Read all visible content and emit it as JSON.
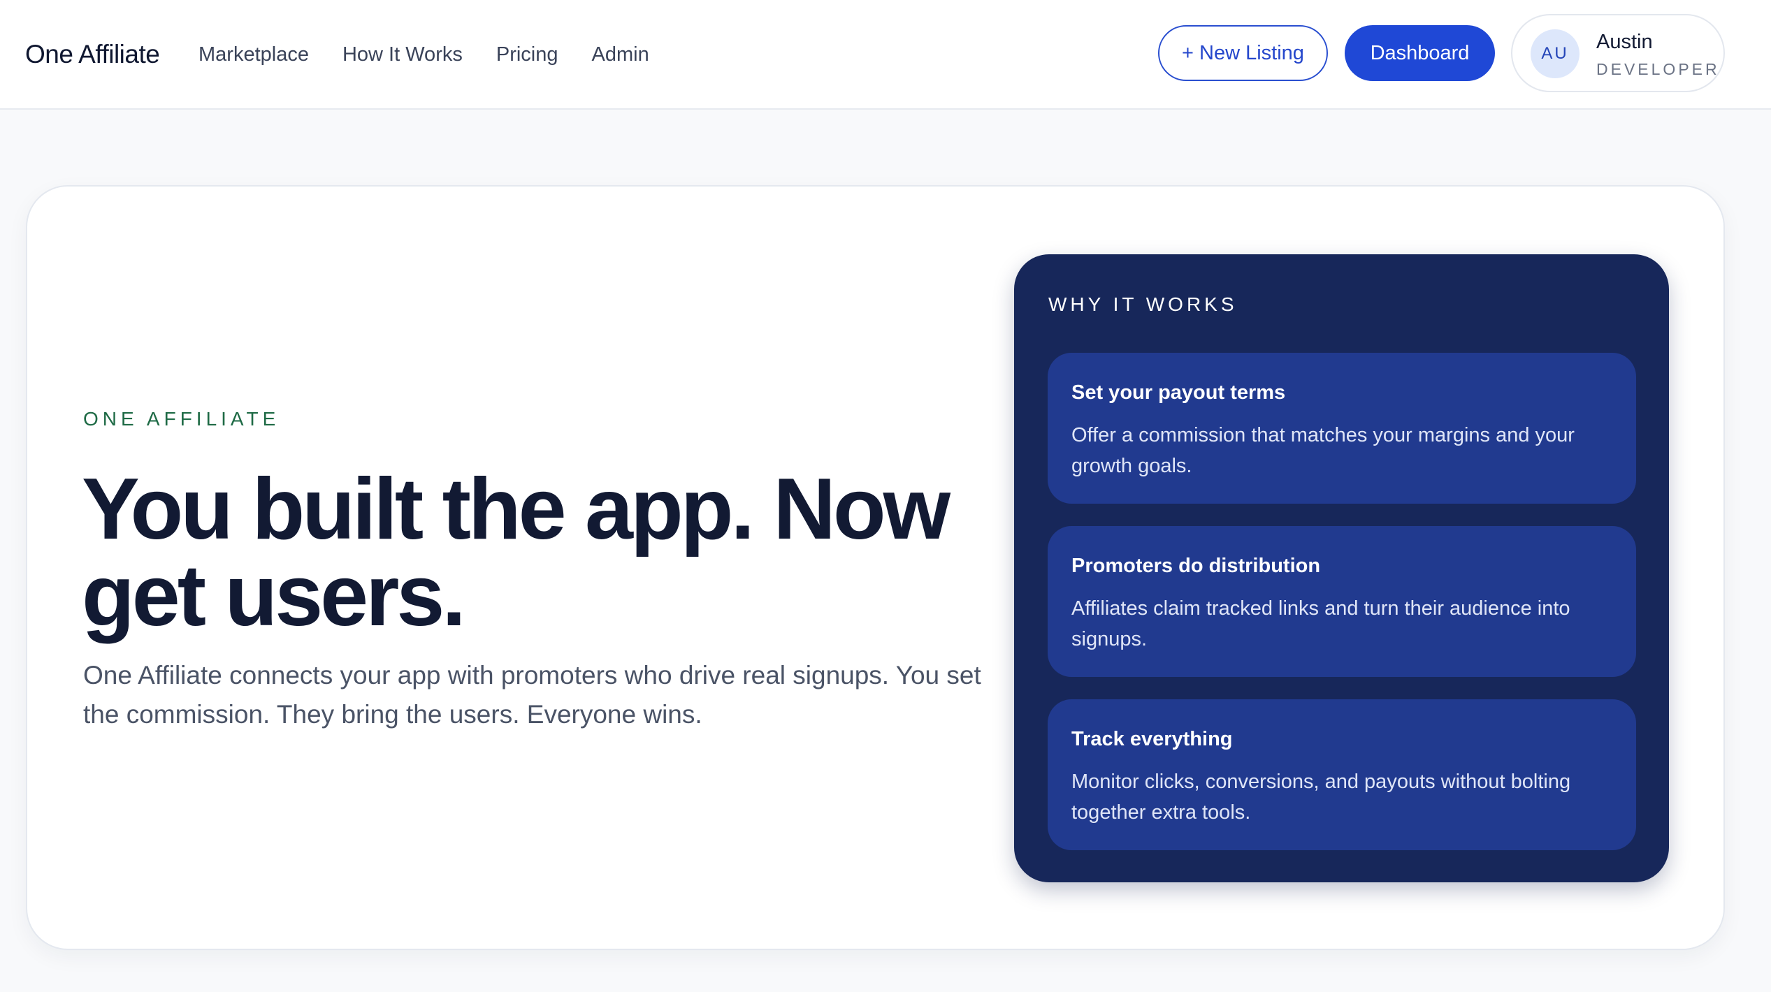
{
  "header": {
    "brand": "One Affiliate",
    "nav": [
      {
        "label": "Marketplace"
      },
      {
        "label": "How It Works"
      },
      {
        "label": "Pricing"
      },
      {
        "label": "Admin"
      }
    ],
    "new_listing_label": "+ New Listing",
    "dashboard_label": "Dashboard",
    "user": {
      "initials": "AU",
      "name": "Austin",
      "role": "DEVELOPER"
    }
  },
  "hero": {
    "eyebrow": "ONE AFFILIATE",
    "headline": "You built the app. Now get users.",
    "subtext": "One Affiliate connects your app with promoters who drive real signups. You set the commission. They bring the users. Everyone wins."
  },
  "why": {
    "title": "WHY IT WORKS",
    "cards": [
      {
        "title": "Set your payout terms",
        "body": "Offer a commission that matches your margins and your growth goals."
      },
      {
        "title": "Promoters do distribution",
        "body": "Affiliates claim tracked links and turn their audience into signups."
      },
      {
        "title": "Track everything",
        "body": "Monitor clicks, conversions, and payouts without bolting together extra tools."
      }
    ]
  },
  "colors": {
    "primary": "#1f48d6",
    "panel": "#17275a",
    "panel_card": "#213a8f",
    "eyebrow": "#1e6a45"
  }
}
